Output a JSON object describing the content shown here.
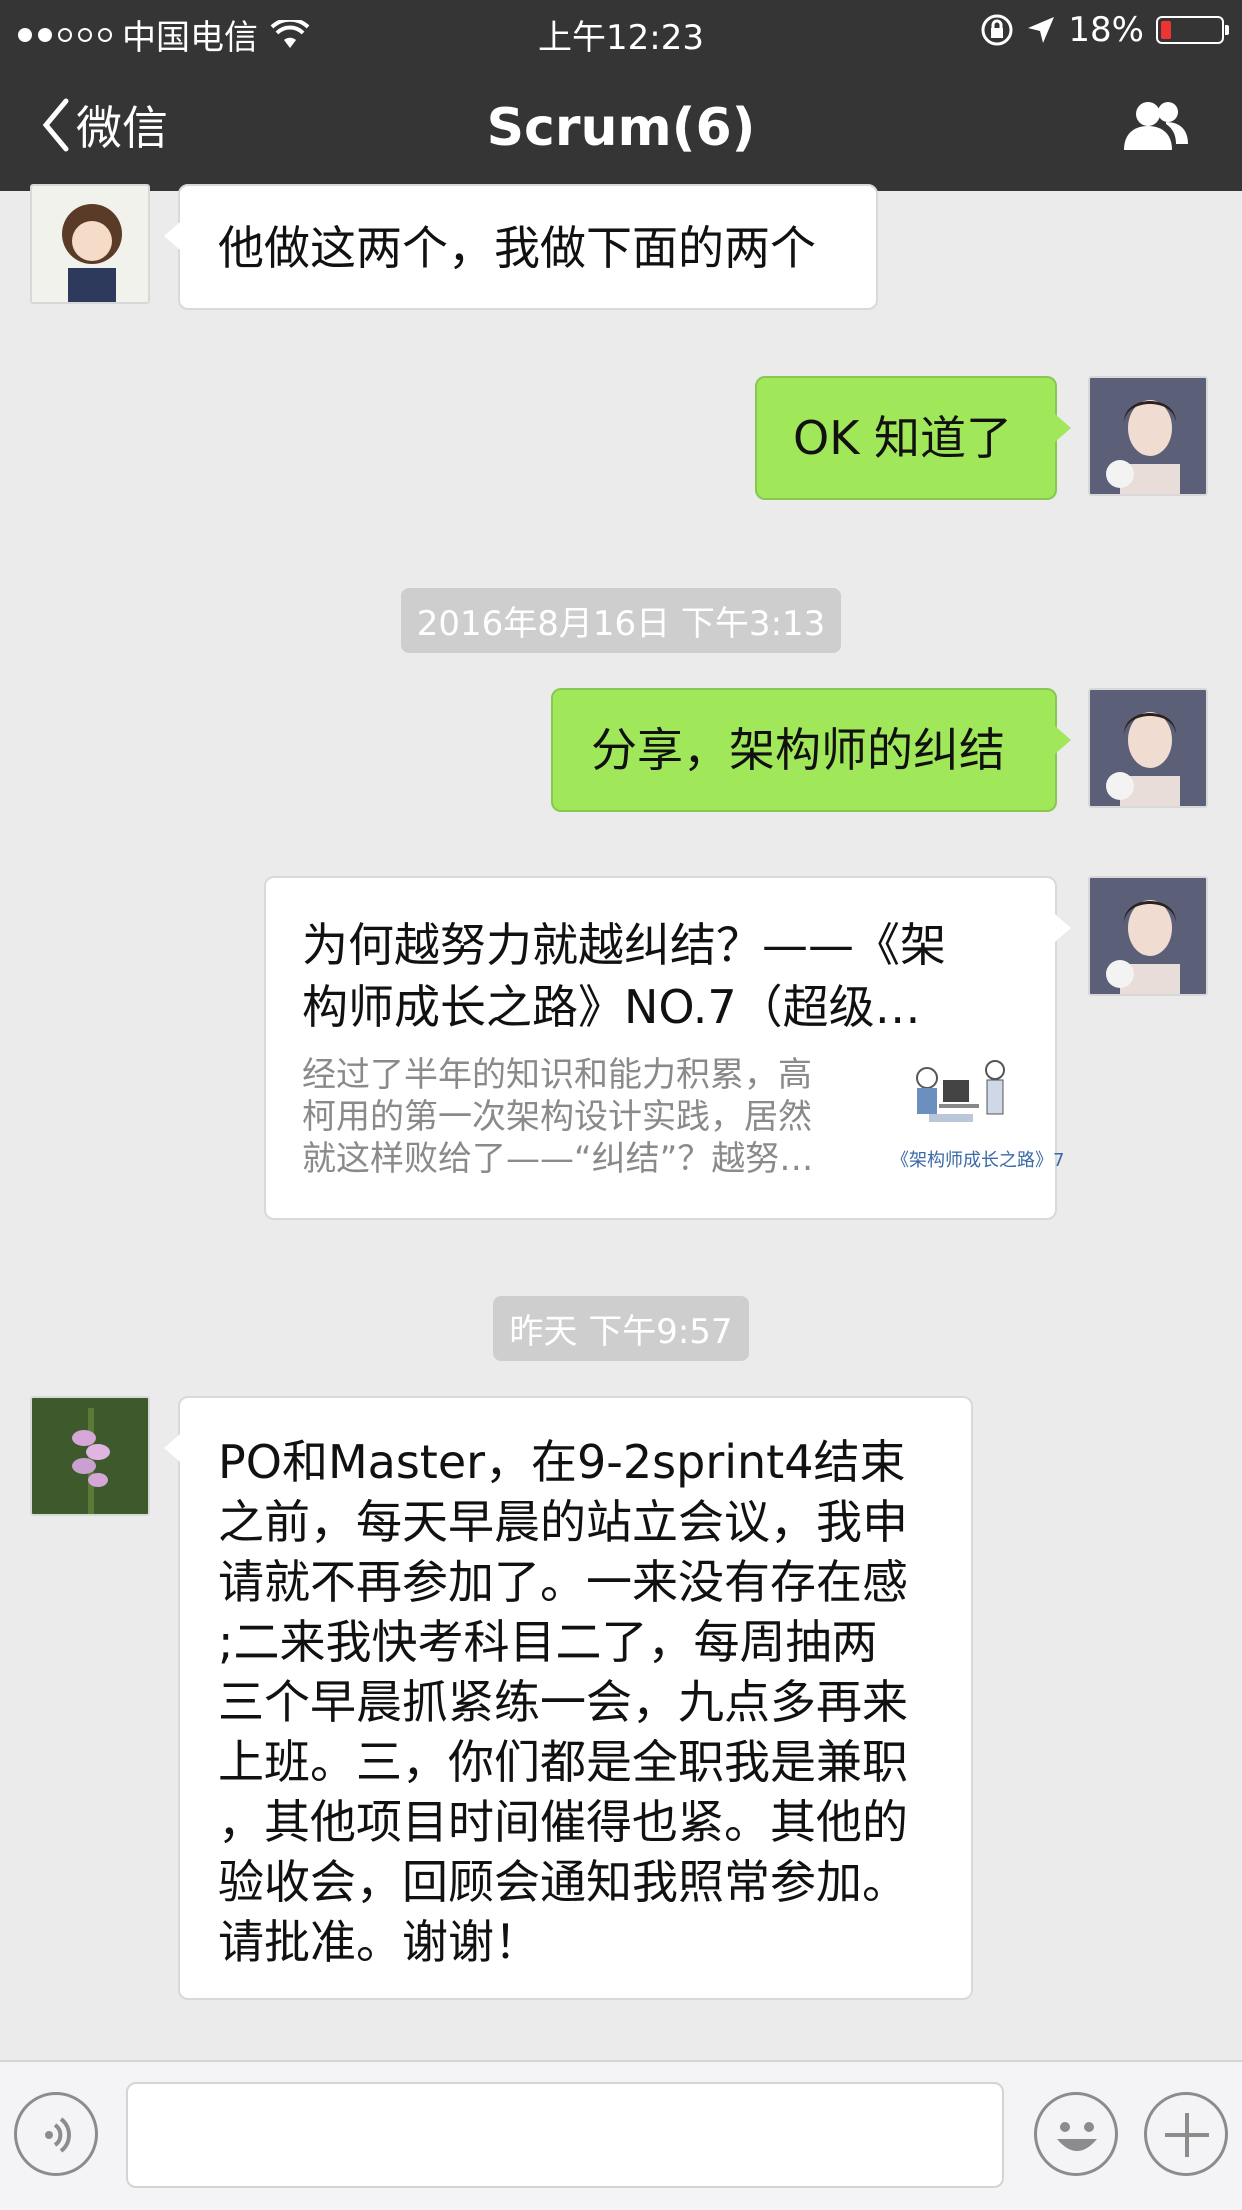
{
  "status_bar": {
    "carrier": "中国电信",
    "time": "上午12:23",
    "battery": "18%",
    "battery_level": 0.18
  },
  "nav": {
    "back_label": "微信",
    "title": "Scrum(6)"
  },
  "messages": [
    {
      "side": "left",
      "text": "他做这两个，我做下面的两个"
    },
    {
      "side": "right",
      "text": "OK 知道了"
    },
    {
      "timestamp": "2016年8月16日 下午3:13"
    },
    {
      "side": "right",
      "text": "分享，架构师的纠结"
    },
    {
      "side": "right",
      "type": "link_card",
      "title": "为何越努力就越纠结？——《架构师成长之路》NO.7（超级…",
      "title_line1": "为何越努力就越纠结？——《架",
      "title_line2": "构师成长之路》NO.7（超级…",
      "desc_line1": "经过了半年的知识和能力积累，高",
      "desc_line2": "柯用的第一次架构设计实践，居然",
      "desc_line3": "就这样败给了——“纠结”？越努…",
      "thumb_caption": "《架构师成长之路》7"
    },
    {
      "timestamp": "昨天 下午9:57"
    },
    {
      "side": "left",
      "lines": [
        "PO和Master，在9-2sprint4结束",
        "之前，每天早晨的站立会议，我申",
        "请就不再参加了。一来没有存在感",
        ";二来我快考科目二了，每周抽两",
        "三个早晨抓紧练一会，九点多再来",
        "上班。三，你们都是全职我是兼职",
        "，其他项目时间催得也紧。其他的",
        "验收会，回顾会通知我照常参加。",
        "请批准。谢谢！"
      ]
    }
  ],
  "input_bar": {
    "placeholder": ""
  },
  "colors": {
    "nav_bg": "#353535",
    "chat_bg": "#ebebeb",
    "bubble_green": "#a0e75a",
    "bubble_white": "#ffffff"
  }
}
